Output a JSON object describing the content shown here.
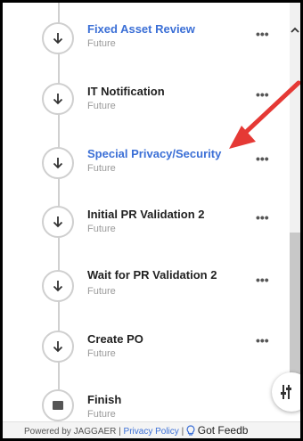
{
  "steps": [
    {
      "title": "Fixed Asset Review",
      "status": "Future",
      "link": true,
      "icon": "arrow-down-icon"
    },
    {
      "title": "IT Notification",
      "status": "Future",
      "link": false,
      "icon": "arrow-down-icon"
    },
    {
      "title": "Special Privacy/Security",
      "status": "Future",
      "link": true,
      "icon": "arrow-down-icon"
    },
    {
      "title": "Initial PR Validation 2",
      "status": "Future",
      "link": false,
      "icon": "arrow-down-icon"
    },
    {
      "title": "Wait for PR Validation 2",
      "status": "Future",
      "link": false,
      "icon": "arrow-down-icon"
    },
    {
      "title": "Create PO",
      "status": "Future",
      "link": false,
      "icon": "arrow-down-icon"
    },
    {
      "title": "Finish",
      "status": "Future",
      "link": false,
      "icon": "stop-square-icon"
    }
  ],
  "more_label": "•••",
  "footer": {
    "powered_by": "Powered by JAGGAER",
    "separator": "|",
    "privacy_policy": "Privacy Policy",
    "feedback": "Got Feedb"
  },
  "colors": {
    "link": "#3b6fd6",
    "annotation_arrow": "#e53935"
  }
}
